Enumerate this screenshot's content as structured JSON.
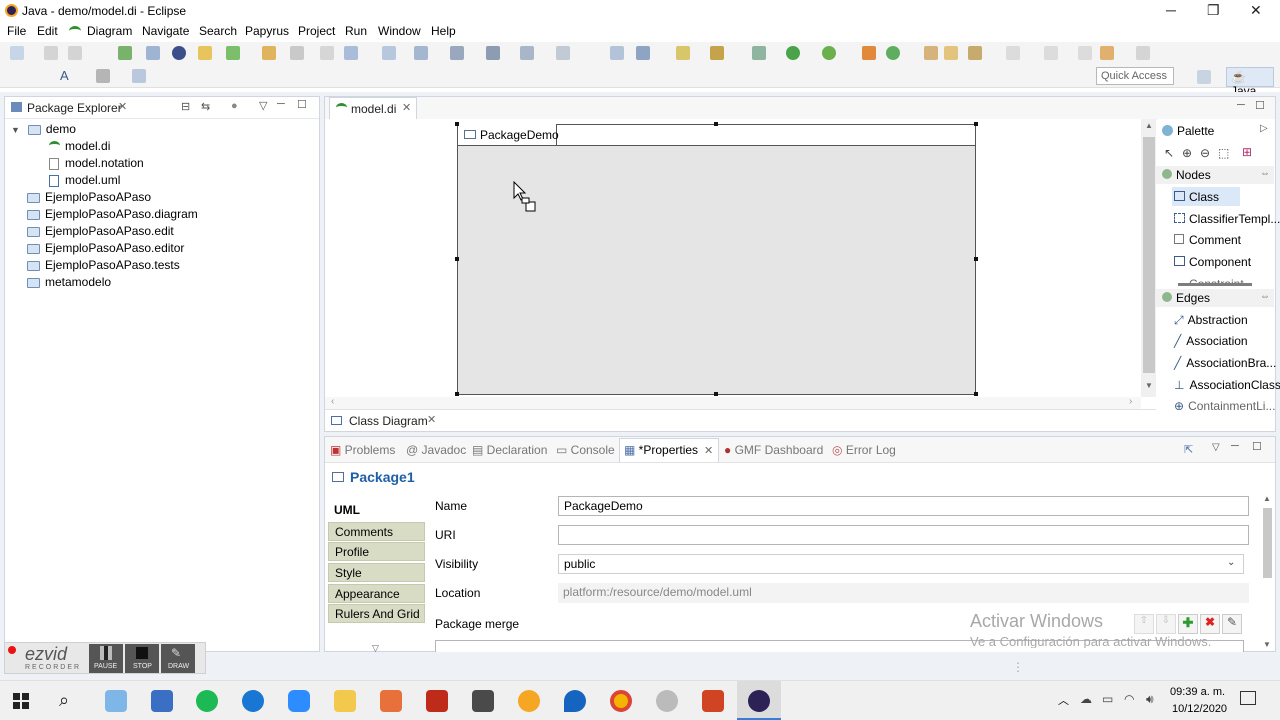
{
  "window": {
    "title": "Java - demo/model.di - Eclipse",
    "minimize": "─",
    "restore": "❐",
    "close": "✕"
  },
  "menu": [
    "File",
    "Edit",
    "Diagram",
    "Navigate",
    "Search",
    "Papyrus",
    "Project",
    "Run",
    "Window",
    "Help"
  ],
  "quick_access": {
    "placeholder": "Quick Access"
  },
  "perspective": {
    "label": "Java"
  },
  "package_explorer": {
    "title": "Package Explorer",
    "tree": [
      {
        "label": "demo",
        "level": 0,
        "type": "project",
        "expanded": true
      },
      {
        "label": "model.di",
        "level": 1,
        "type": "di"
      },
      {
        "label": "model.notation",
        "level": 1,
        "type": "file"
      },
      {
        "label": "model.uml",
        "level": 1,
        "type": "uml"
      },
      {
        "label": "EjemploPasoAPaso",
        "level": 0,
        "type": "project"
      },
      {
        "label": "EjemploPasoAPaso.diagram",
        "level": 0,
        "type": "project"
      },
      {
        "label": "EjemploPasoAPaso.edit",
        "level": 0,
        "type": "project"
      },
      {
        "label": "EjemploPasoAPaso.editor",
        "level": 0,
        "type": "project"
      },
      {
        "label": "EjemploPasoAPaso.tests",
        "level": 0,
        "type": "project"
      },
      {
        "label": "metamodelo",
        "level": 0,
        "type": "project"
      }
    ]
  },
  "editor": {
    "tab": "model.di",
    "package_name": "PackageDemo",
    "bottom_tab": "Class Diagram"
  },
  "palette": {
    "title": "Palette",
    "nodes_title": "Nodes",
    "nodes": [
      "Class",
      "ClassifierTempl...",
      "Comment",
      "Component",
      "Constraint"
    ],
    "edges_title": "Edges",
    "edges": [
      "Abstraction",
      "Association",
      "AssociationBra...",
      "AssociationClass",
      "ContainmentLi..."
    ]
  },
  "bottom_tabs": [
    "Problems",
    "Javadoc",
    "Declaration",
    "Console",
    "*Properties",
    "GMF Dashboard",
    "Error Log"
  ],
  "properties": {
    "title": "Package1",
    "sections": [
      "UML",
      "Comments",
      "Profile",
      "Style",
      "Appearance",
      "Rulers And Grid"
    ],
    "fields": {
      "name_label": "Name",
      "name_value": "PackageDemo",
      "uri_label": "URI",
      "uri_value": "",
      "visibility_label": "Visibility",
      "visibility_value": "public",
      "location_label": "Location",
      "location_value": "platform:/resource/demo/model.uml",
      "merge_label": "Package merge"
    }
  },
  "activation_watermark": {
    "line1": "Activar Windows",
    "line2": "Ve a Configuración para activar Windows."
  },
  "recorder": {
    "brand": "ezvid",
    "sub": "RECORDER",
    "pause": "PAUSE",
    "stop": "STOP",
    "draw": "DRAW"
  },
  "clock": {
    "time": "09:39 a. m.",
    "date": "10/12/2020"
  },
  "colors": {
    "accent": "#1f5fa8",
    "spotify": "#1db954",
    "filezilla": "#bf2b1a"
  }
}
